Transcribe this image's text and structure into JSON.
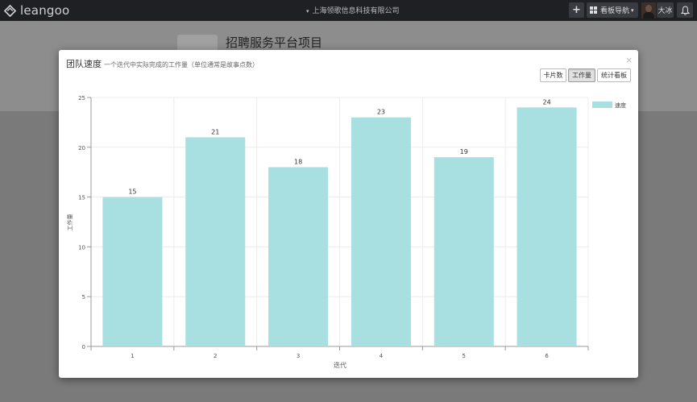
{
  "topbar": {
    "logo_text": "leangoo",
    "company": "上海领歌信息科技有限公司",
    "add_icon": "plus-icon",
    "board_nav_label": "看板导航",
    "user_name": "大冰",
    "bell_icon": "bell-icon"
  },
  "page": {
    "project_title": "招聘服务平台项目"
  },
  "modal": {
    "title": "团队速度",
    "subtitle": "一个迭代中实际完成的工作量（单位通常是故事点数）",
    "close": "×",
    "buttons": [
      {
        "label": "卡片数",
        "active": false
      },
      {
        "label": "工作量",
        "active": true
      },
      {
        "label": "统计看板",
        "active": false
      }
    ]
  },
  "chart_data": {
    "type": "bar",
    "categories": [
      "1",
      "2",
      "3",
      "4",
      "5",
      "6"
    ],
    "series": [
      {
        "name": "速度",
        "values": [
          15,
          21,
          18,
          23,
          19,
          24
        ]
      }
    ],
    "xlabel": "迭代",
    "ylabel": "工作量",
    "ylim": [
      0,
      25
    ],
    "yticks": [
      0,
      5,
      10,
      15,
      20,
      25
    ],
    "grid": true,
    "legend": "top-right",
    "bar_color": "#a8dfe0"
  }
}
